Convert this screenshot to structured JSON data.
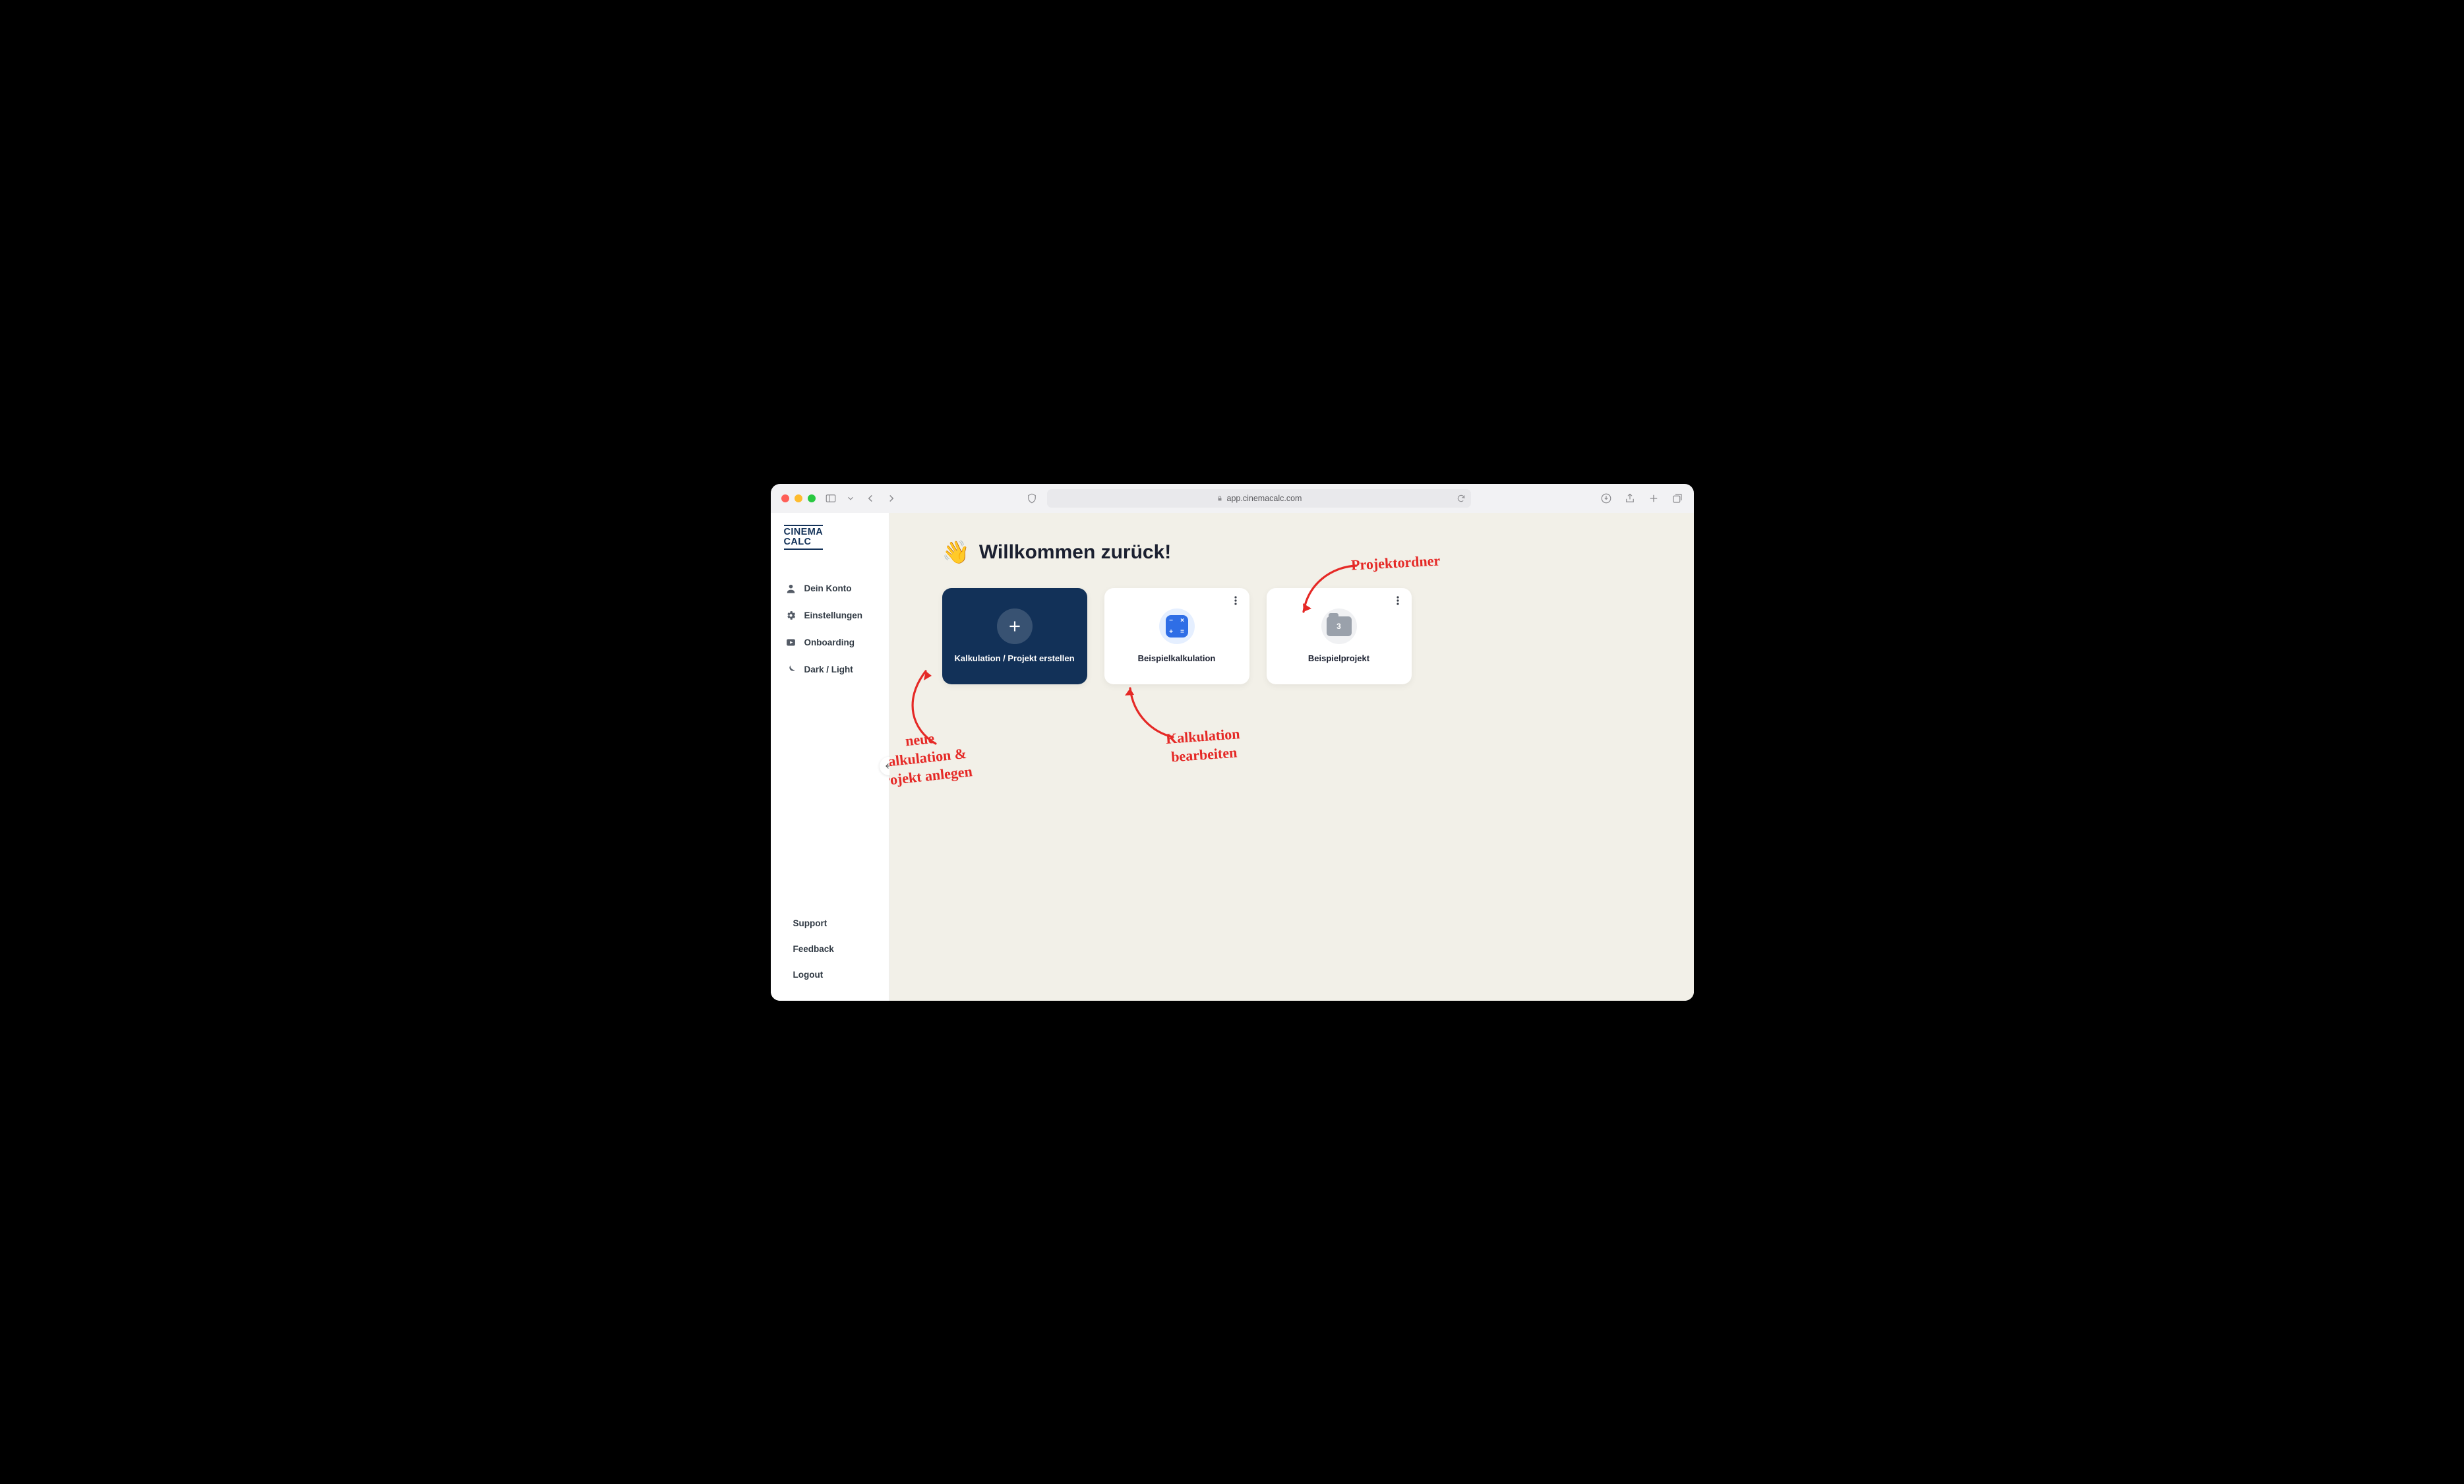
{
  "browser": {
    "address": "app.cinemacalc.com"
  },
  "sidebar": {
    "logo_line1": "CINEMA",
    "logo_line2": "CALC",
    "items": [
      {
        "label": "Dein Konto"
      },
      {
        "label": "Einstellungen"
      },
      {
        "label": "Onboarding"
      },
      {
        "label": "Dark / Light"
      }
    ],
    "bottom": [
      {
        "label": "Support"
      },
      {
        "label": "Feedback"
      },
      {
        "label": "Logout"
      }
    ]
  },
  "main": {
    "wave_emoji": "👋",
    "heading": "Willkommen zurück!",
    "cards": {
      "create": {
        "title": "Kalkulation / Projekt erstellen"
      },
      "calc": {
        "title": "Beispielkalkulation"
      },
      "proj": {
        "title": "Beispielprojekt",
        "folder_count": "3"
      }
    }
  },
  "annotations": {
    "create": "neue\nKalkulation &\nProjekt anlegen",
    "calc": "Kalkulation\nbearbeiten",
    "folder": "Projektordner"
  }
}
